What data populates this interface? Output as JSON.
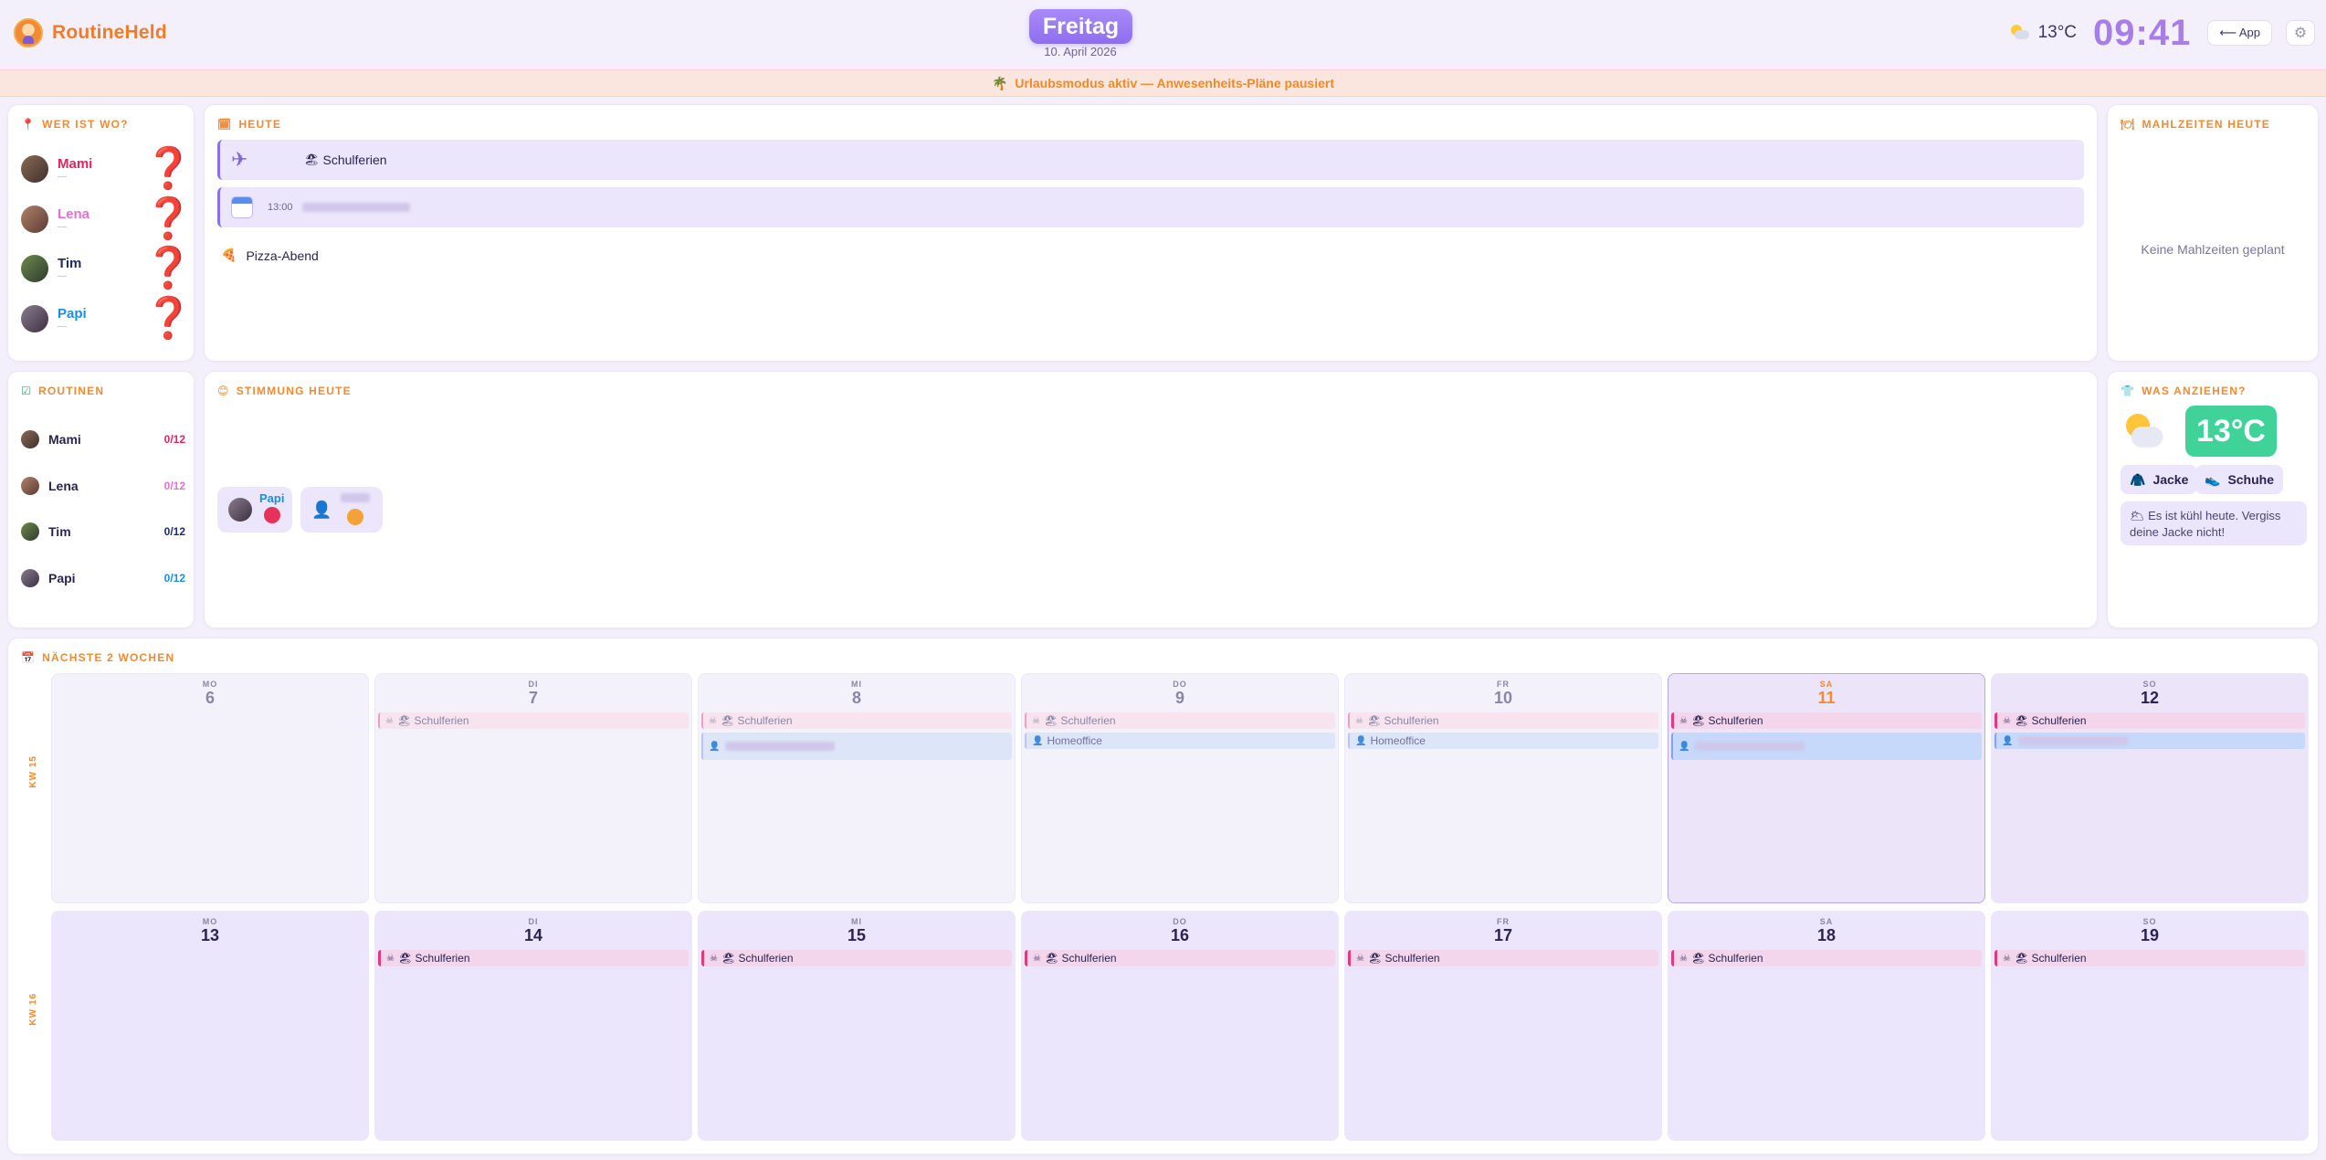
{
  "header": {
    "brand": "RoutineHeld",
    "day": "Freitag",
    "date": "10. April 2026",
    "temperature": "13°C",
    "clock": "09:41",
    "app_button": "⟵ App",
    "settings_icon": "gear-icon"
  },
  "banner": {
    "icon": "🌴",
    "text": "Urlaubsmodus aktiv — Anwesenheits-Pläne pausiert"
  },
  "who": {
    "title": "WER IST WO?",
    "icon": "📍",
    "members": [
      {
        "name": "Mami",
        "sub": "—",
        "status": "❓",
        "color": "#e0245e"
      },
      {
        "name": "Lena",
        "sub": "—",
        "status": "❓",
        "color": "#e86fd0"
      },
      {
        "name": "Tim",
        "sub": "—",
        "status": "❓",
        "color": "#1f2a6b"
      },
      {
        "name": "Papi",
        "sub": "—",
        "status": "❓",
        "color": "#1a8fe0"
      }
    ]
  },
  "today": {
    "title": "HEUTE",
    "icon": "🗓",
    "events": [
      {
        "icon": "✈",
        "emoji": "🏖",
        "label": "Schulferien"
      },
      {
        "icon": "calendar-icon",
        "time": "13:00",
        "label": ""
      }
    ],
    "pizza": {
      "icon": "🍕",
      "label": "Pizza-Abend"
    }
  },
  "meals": {
    "title": "MAHLZEITEN HEUTE",
    "icon": "🍽",
    "empty": "Keine Mahlzeiten geplant"
  },
  "routines": {
    "title": "ROUTINEN",
    "icon": "☑",
    "rows": [
      {
        "name": "Mami",
        "count": "0/12",
        "color": "#e0245e"
      },
      {
        "name": "Lena",
        "count": "0/12",
        "color": "#e86fd0"
      },
      {
        "name": "Tim",
        "count": "0/12",
        "color": "#1f2a6b"
      },
      {
        "name": "Papi",
        "count": "0/12",
        "color": "#1a8fe0"
      }
    ]
  },
  "mood": {
    "title": "STIMMUNG HEUTE",
    "icon": "😊",
    "entries": [
      {
        "name": "Papi",
        "emoji": "😡",
        "emoji_color": "#e8315a"
      },
      {
        "name": "",
        "emoji": "🥵",
        "emoji_color": "#f3a23a"
      }
    ]
  },
  "clothing": {
    "title": "WAS ANZIEHEN?",
    "icon": "👕",
    "temperature": "13°C",
    "weather_icon": "sun-behind-cloud-icon",
    "items": [
      {
        "icon": "🧥",
        "label": "Jacke"
      },
      {
        "icon": "👟",
        "label": "Schuhe"
      }
    ],
    "tip": "🌥 Es ist kühl heute. Vergiss deine Jacke nicht!",
    "accent": "#3fd39a"
  },
  "calendar": {
    "title": "NÄCHSTE 2 WOCHEN",
    "icon": "📅",
    "weeks": [
      {
        "label": "KW 15",
        "days": [
          {
            "dow": "MO",
            "num": "6",
            "events": []
          },
          {
            "dow": "DI",
            "num": "7",
            "events": [
              {
                "text": "🏖 Schulferien",
                "kind": "pink"
              }
            ]
          },
          {
            "dow": "MI",
            "num": "8",
            "events": [
              {
                "text": "🏖 Schulferien",
                "kind": "pink"
              },
              {
                "text": "",
                "kind": "blue-tall"
              }
            ]
          },
          {
            "dow": "DO",
            "num": "9",
            "events": [
              {
                "text": "🏖 Schulferien",
                "kind": "pink"
              },
              {
                "text": "Homeoffice",
                "kind": "blue"
              }
            ]
          },
          {
            "dow": "FR",
            "num": "10",
            "events": [
              {
                "text": "🏖 Schulferien",
                "kind": "pink"
              },
              {
                "text": "Homeoffice",
                "kind": "blue"
              }
            ]
          },
          {
            "dow": "SA",
            "num": "11",
            "events": [
              {
                "text": "🏖 Schulferien",
                "kind": "pink"
              },
              {
                "text": "",
                "kind": "blue-strong-tall"
              }
            ]
          },
          {
            "dow": "SO",
            "num": "12",
            "events": [
              {
                "text": "🏖 Schulferien",
                "kind": "pink"
              },
              {
                "text": "",
                "kind": "blue-strong"
              }
            ]
          }
        ]
      },
      {
        "label": "KW 16",
        "days": [
          {
            "dow": "MO",
            "num": "13",
            "events": []
          },
          {
            "dow": "DI",
            "num": "14",
            "events": [
              {
                "text": "🏖 Schulferien",
                "kind": "pink"
              }
            ]
          },
          {
            "dow": "MI",
            "num": "15",
            "events": [
              {
                "text": "🏖 Schulferien",
                "kind": "pink"
              }
            ]
          },
          {
            "dow": "DO",
            "num": "16",
            "events": [
              {
                "text": "🏖 Schulferien",
                "kind": "pink"
              }
            ]
          },
          {
            "dow": "FR",
            "num": "17",
            "events": [
              {
                "text": "🏖 Schulferien",
                "kind": "pink"
              }
            ]
          },
          {
            "dow": "SA",
            "num": "18",
            "events": [
              {
                "text": "🏖 Schulferien",
                "kind": "pink"
              }
            ]
          },
          {
            "dow": "SO",
            "num": "19",
            "events": [
              {
                "text": "🏖 Schulferien",
                "kind": "pink"
              }
            ]
          }
        ]
      }
    ]
  }
}
